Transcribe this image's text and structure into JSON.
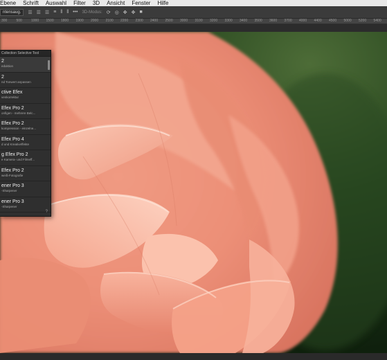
{
  "menubar": {
    "items": [
      "Ebene",
      "Schrift",
      "Auswahl",
      "Filter",
      "3D",
      "Ansicht",
      "Fenster",
      "Hilfe"
    ]
  },
  "optionsbar": {
    "label": "ntensaug.",
    "mode": "3D-Modus:"
  },
  "ruler": {
    "ticks": [
      "300",
      "500",
      "1000",
      "1500",
      "1800",
      "1900",
      "2000",
      "2100",
      "2200",
      "2300",
      "2400",
      "2500",
      "3000",
      "3100",
      "3200",
      "3300",
      "3400",
      "3500",
      "3600",
      "3700",
      "4000",
      "4400",
      "4500",
      "5000",
      "5200",
      "5400"
    ]
  },
  "panel": {
    "header": "Collection Selective Tool",
    "items": [
      {
        "title": "2",
        "subtitle": "eduktion"
      },
      {
        "title": "2",
        "subtitle": "nd Tonwert anpassen"
      },
      {
        "title": "ctive Efex",
        "subtitle": "venkorrektur"
      },
      {
        "title": "Efex Pro 2",
        "subtitle": "onfigen - mehrere Belc..."
      },
      {
        "title": "Efex Pro 2",
        "subtitle": "kompression - einzelne..."
      },
      {
        "title": "Efex Pro 4",
        "subtitle": "d und Kreativeffekte"
      },
      {
        "title": "g Efex Pro 2",
        "subtitle": "e Kamera- und Filmeff..."
      },
      {
        "title": "Efex Pro 2",
        "subtitle": "weiß-Fotografie"
      },
      {
        "title": "ener Pro 3",
        "subtitle": "-Sharpener"
      },
      {
        "title": "ener Pro 3",
        "subtitle": "-Sharpener"
      }
    ],
    "help": "?"
  },
  "colors": {
    "petal_light": "#f6b9a4",
    "petal_mid": "#ee9b83",
    "petal_dark": "#c9604d",
    "foliage": "#23401c",
    "panel_bg": "#2f2f2f"
  }
}
